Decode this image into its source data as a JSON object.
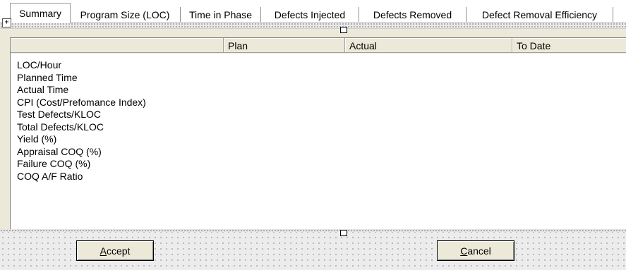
{
  "tabs": [
    {
      "label": "Summary",
      "active": true
    },
    {
      "label": "Program Size (LOC)",
      "active": false
    },
    {
      "label": "Time in Phase",
      "active": false
    },
    {
      "label": "Defects Injected",
      "active": false
    },
    {
      "label": "Defects Removed",
      "active": false
    },
    {
      "label": "Defect Removal Efficiency",
      "active": false
    }
  ],
  "grid": {
    "columns": [
      "",
      "Plan",
      "Actual",
      "To Date"
    ],
    "rows": [
      "LOC/Hour",
      "Planned Time",
      "Actual Time",
      "CPI (Cost/Prefomance Index)",
      "Test Defects/KLOC",
      "Total Defects/KLOC",
      "Yield (%)",
      "Appraisal COQ (%)",
      "Failure COQ (%)",
      "COQ A/F Ratio"
    ]
  },
  "buttons": {
    "accept": {
      "accel": "A",
      "rest": "ccept"
    },
    "cancel": {
      "accel": "C",
      "rest": "ancel"
    }
  }
}
